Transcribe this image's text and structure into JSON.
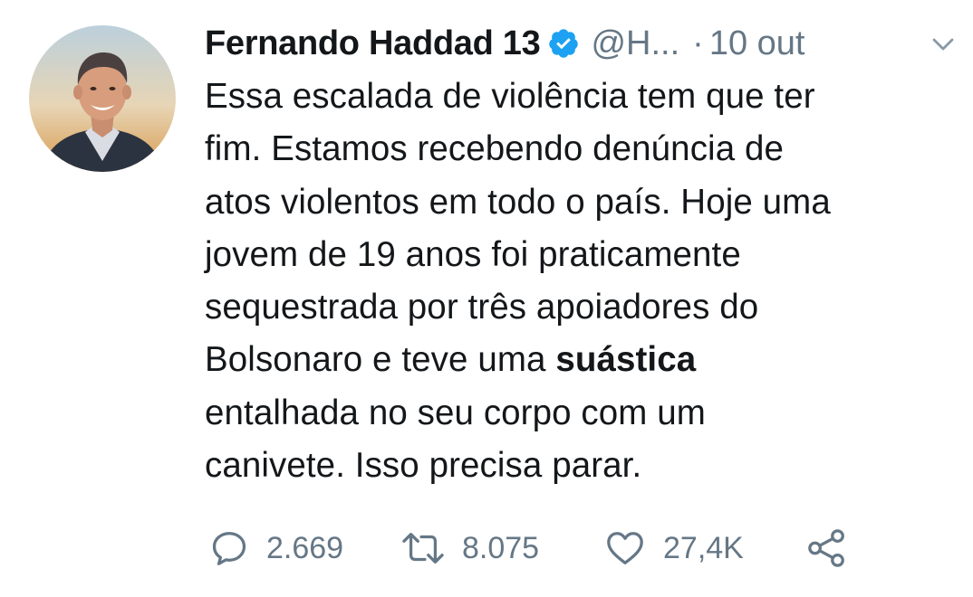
{
  "tweet": {
    "author": {
      "name": "Fernando Haddad 13",
      "handle": "@H...",
      "verified": true,
      "avatar_icon": "profile-photo"
    },
    "separator": "·",
    "time": "10 out",
    "text_lines": [
      "Essa escalada de violência tem que ter",
      "fim. Estamos recebendo denúncia de",
      "atos violentos em todo o país. Hoje uma",
      "jovem de 19 anos foi praticamente",
      "sequestrada por três apoiadores do"
    ],
    "line6_before_bold": "Bolsonaro e teve uma ",
    "line6_bold": "suástica",
    "text_lines_end": [
      "entalhada no seu corpo com um",
      "canivete. Isso precisa parar."
    ],
    "actions": {
      "reply": {
        "icon": "reply-icon",
        "count": "2.669"
      },
      "retweet": {
        "icon": "retweet-icon",
        "count": "8.075"
      },
      "like": {
        "icon": "heart-icon",
        "count": "27,4K"
      },
      "share": {
        "icon": "share-icon"
      }
    }
  },
  "colors": {
    "text": "#14171a",
    "secondary": "#657786",
    "verified": "#1da1f2"
  }
}
